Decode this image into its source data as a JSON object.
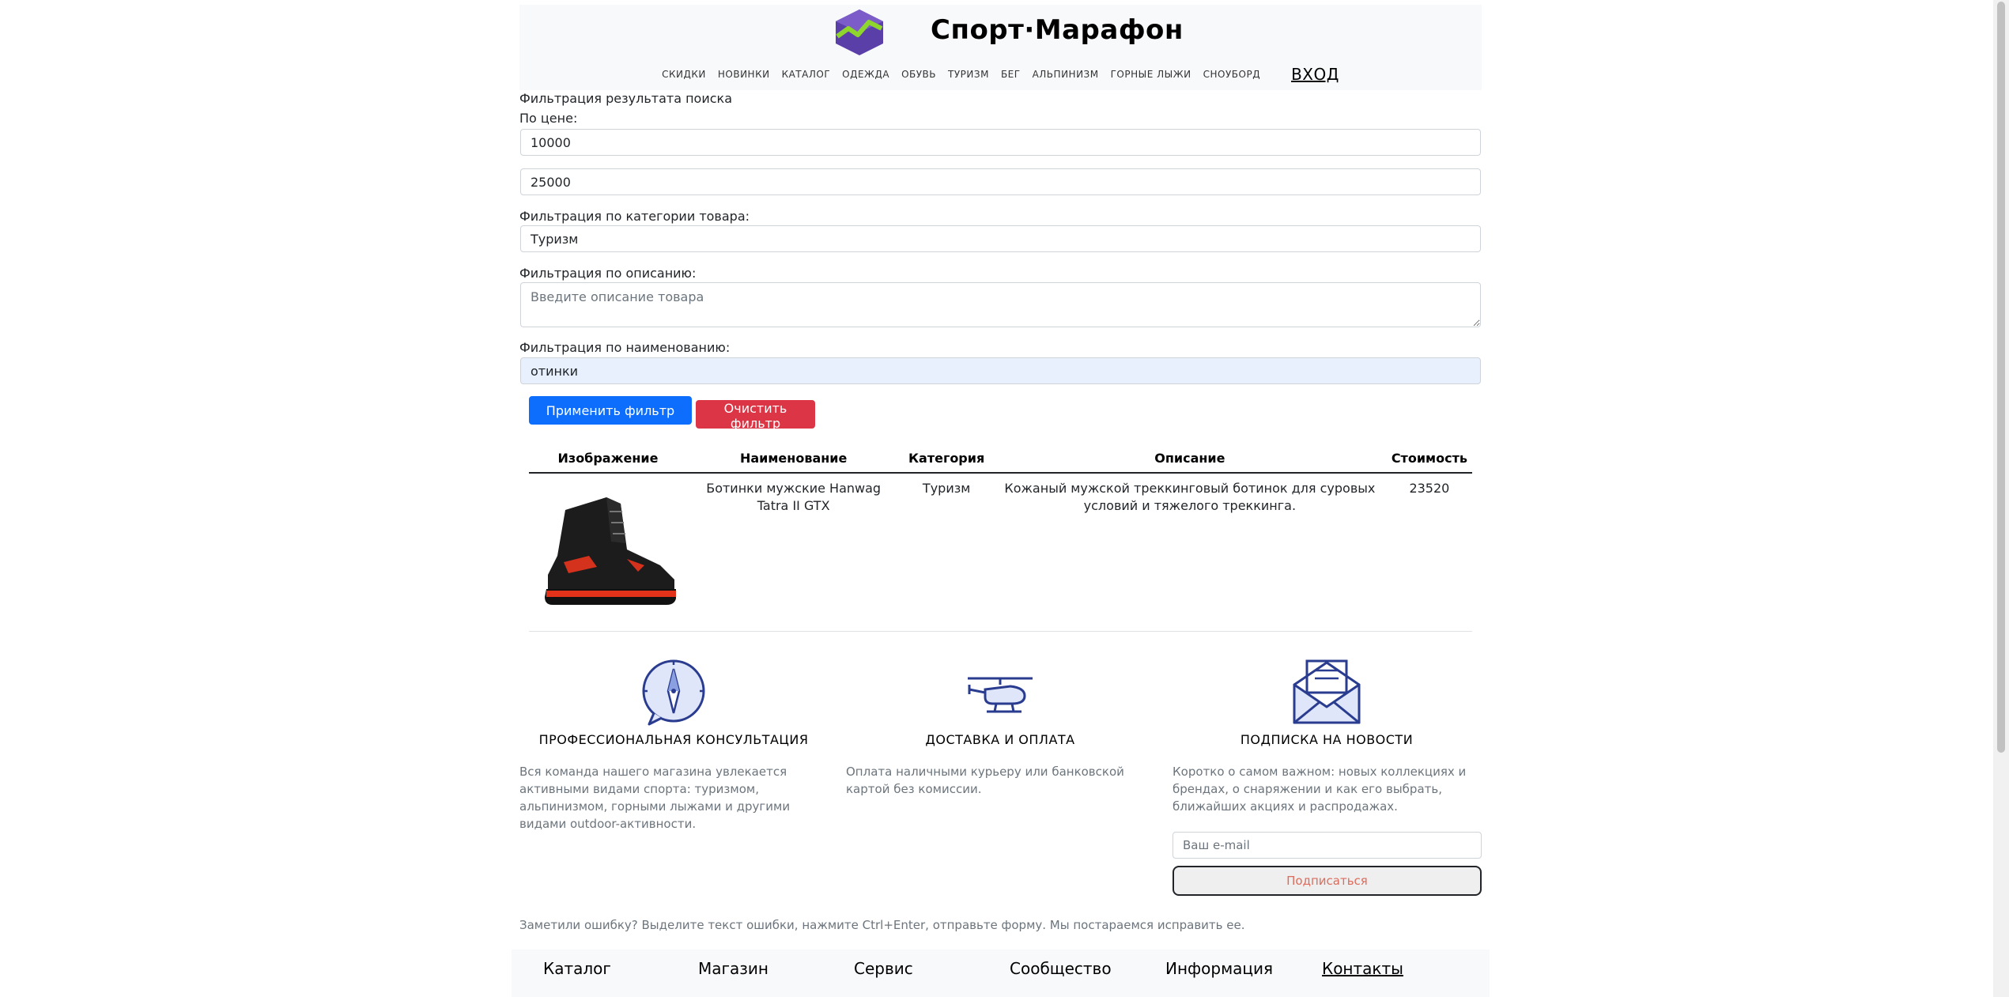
{
  "header": {
    "brand": "Спорт·Марафон",
    "nav": [
      "СКИДКИ",
      "НОВИНКИ",
      "КАТАЛОГ",
      "ОДЕЖДА",
      "ОБУВЬ",
      "ТУРИЗМ",
      "БЕГ",
      "АЛЬПИНИЗМ",
      "ГОРНЫЕ ЛЫЖИ",
      "СНОУБОРД"
    ],
    "login": "ВХОД"
  },
  "filter": {
    "title": "Фильтрация результата поиска",
    "price_label": "По цене:",
    "price_min": "10000",
    "price_max": "25000",
    "category_label": "Фильтрация по категории товара:",
    "category_value": "Туризм",
    "description_label": "Фильтрация по описанию:",
    "description_placeholder": "Введите описание товара",
    "name_label": "Фильтрация по наименованию:",
    "name_value": "отинки",
    "apply_label": "Применить фильтр",
    "clear_label": "Очистить фильтр"
  },
  "table": {
    "headers": [
      "Изображение",
      "Наименование",
      "Категория",
      "Описание",
      "Стоимость"
    ],
    "rows": [
      {
        "name": "Ботинки мужские Hanwag Tatra II GTX",
        "category": "Туризм",
        "description": "Кожаный мужской треккинговый ботинок для суровых условий и тяжелого треккинга.",
        "price": "23520"
      }
    ]
  },
  "features": [
    {
      "icon": "compass-chat-icon",
      "title": "ПРОФЕССИОНАЛЬНАЯ КОНСУЛЬТАЦИЯ",
      "text": "Вся команда нашего магазина увлекается активными видами спорта: туризмом, альпинизмом, горными лыжами и другими видами outdoor-активности."
    },
    {
      "icon": "helicopter-icon",
      "title": "ДОСТАВКА И ОПЛАТА",
      "text": "Оплата наличными курьеру или банковской картой без комиссии."
    },
    {
      "icon": "envelope-icon",
      "title": "ПОДПИСКА НА НОВОСТИ",
      "text": "Коротко о самом важном: новых коллекциях и брендах, о снаряжении и как его выбрать, ближайших акциях и распродажах."
    }
  ],
  "subscribe": {
    "placeholder": "Ваш e-mail",
    "button": "Подписаться"
  },
  "notice": "Заметили ошибку? Выделите текст ошибки, нажмите Ctrl+Enter, отправьте форму. Мы постараемся исправить ее.",
  "footer": {
    "links": [
      "Каталог",
      "Магазин",
      "Сервис",
      "Сообщество",
      "Информация",
      "Контакты"
    ]
  },
  "colors": {
    "primary": "#0d6efd",
    "danger": "#dc3545",
    "header_bg": "#f8f9fa"
  }
}
